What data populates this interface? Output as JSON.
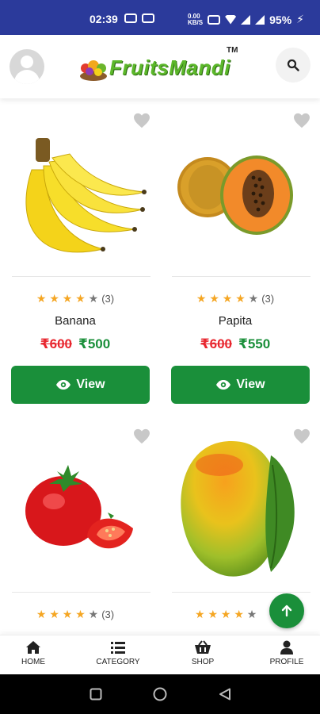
{
  "statusbar": {
    "time": "02:39",
    "data_speed": "0.00\nKB/S",
    "battery": "95%"
  },
  "header": {
    "logo_text": "FruitsMandi",
    "logo_tm": "TM",
    "icons": [
      "avatar-icon",
      "search-icon"
    ]
  },
  "products": [
    {
      "name": "Banana",
      "rating_count": "(3)",
      "stars_filled": 4,
      "old_price": "₹600",
      "new_price": "₹500",
      "button": "View"
    },
    {
      "name": "Papita",
      "rating_count": "(3)",
      "stars_filled": 4,
      "old_price": "₹600",
      "new_price": "₹550",
      "button": "View"
    },
    {
      "name": "Tomato",
      "rating_count": "(3)",
      "stars_filled": 4
    },
    {
      "name": "Mango",
      "stars_filled": 4
    }
  ],
  "bottom_nav": [
    {
      "label": "HOME",
      "icon": "home-icon"
    },
    {
      "label": "CATEGORY",
      "icon": "list-icon"
    },
    {
      "label": "SHOP",
      "icon": "basket-icon"
    },
    {
      "label": "PROFILE",
      "icon": "user-icon"
    }
  ],
  "colors": {
    "statusbar": "#2b3a9b",
    "accent_green": "#1a8f3a",
    "old_price_red": "#e8262e",
    "star": "#f5a623"
  }
}
